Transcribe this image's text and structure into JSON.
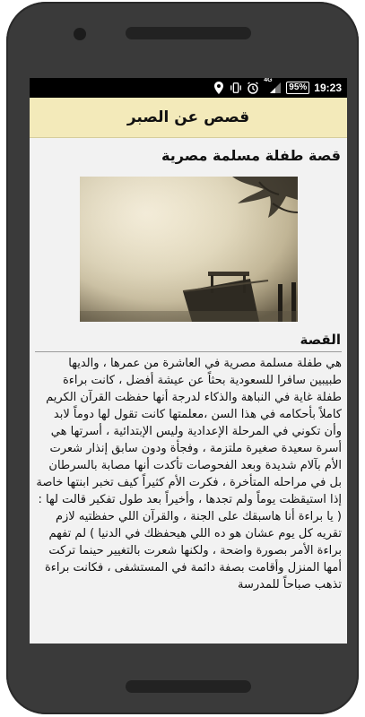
{
  "statusbar": {
    "network": "4G",
    "battery": "95%",
    "time": "19:23",
    "icons": [
      "location-icon",
      "vibrate-icon",
      "alarm-icon",
      "signal-icon",
      "battery-icon"
    ]
  },
  "appbar": {
    "title": "قصص عن الصبر"
  },
  "story": {
    "title": "قصة طفلة مسلمة مصرية",
    "section_title": "القصة",
    "body": "هي طفلة مسلمة مصرية في العاشرة من عمرها ، والديها طبيبين سافرا للسعودية بحثاً عن عيشة أفضل ، كانت براءة طفلة غاية في النباهة والذكاء لدرجة أنها حفظت القرآن الكريم كاملاً بأحكامه في هذا السن ،معلمتها كانت تقول لها دوماً لابد وأن تكوني في المرحلة الإعدادية وليس الإبتدائية ، أسرتها هي أسرة سعيدة صغيرة ملتزمة ، وفجأة ودون سابق إنذار شعرت الأم بآلام شديدة وبعد الفحوصات تأكدت أنها مصابة بالسرطان بل في مراحله المتأخرة ، فكرت الأم كثيراً كيف تخبر ابنتها خاصة إذا استيقظت يوماً ولم تجدها ، وأخيراً بعد طول تفكير قالت لها : ( يا براءة أنا هاسبقك على الجنة ، والقرآن اللي حفظتيه لازم تقريه كل يوم عشان هو ده اللي هيحفظك في الدنيا ) لم تفهم براءة الأمر بصورة واضحة ، ولكنها شعرت بالتغيير حينما تركت أمها المنزل وأقامت بصفة دائمة في المستشفى ، فكانت براءة تذهب صباحاً للمدرسة"
  }
}
